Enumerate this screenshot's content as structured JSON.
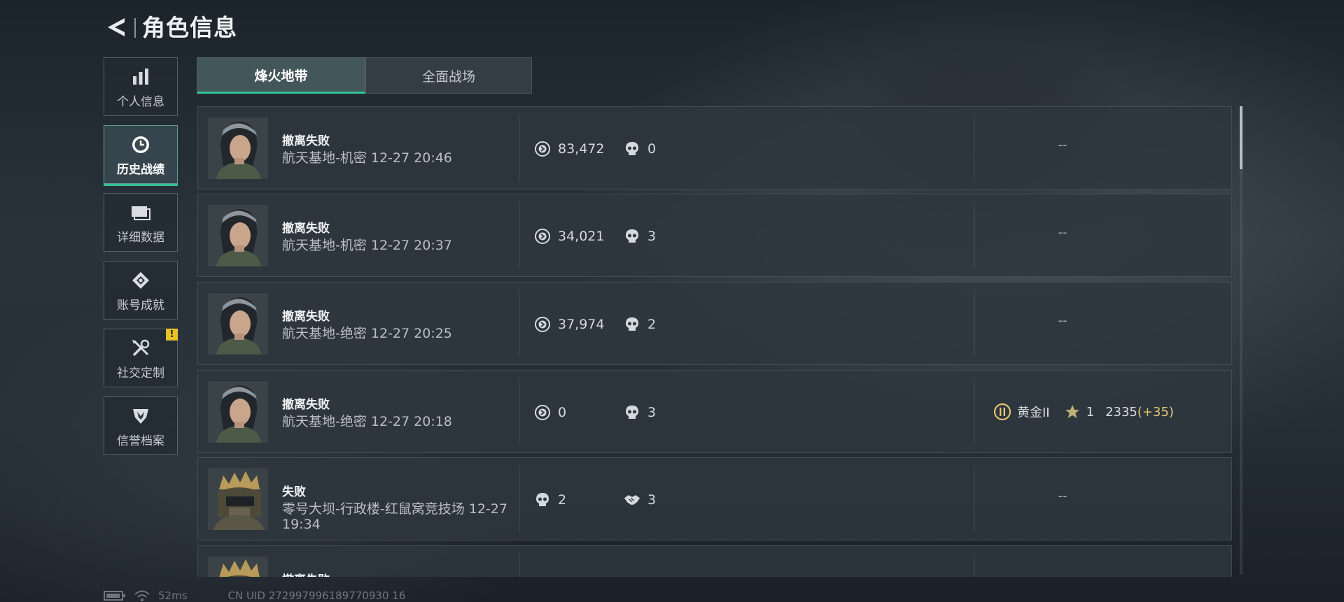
{
  "header": {
    "title": "角色信息",
    "back_icon": "back-arrow-icon"
  },
  "sidebar": {
    "items": [
      {
        "label": "个人信息",
        "icon": "bar-chart-icon",
        "active": false
      },
      {
        "label": "历史战绩",
        "icon": "clock-icon",
        "active": true
      },
      {
        "label": "详细数据",
        "icon": "cards-icon",
        "active": false
      },
      {
        "label": "账号成就",
        "icon": "diamond-badge-icon",
        "active": false
      },
      {
        "label": "社交定制",
        "icon": "tools-icon",
        "active": false,
        "badge": "!"
      },
      {
        "label": "信誉档案",
        "icon": "shield-emblem-icon",
        "active": false
      }
    ]
  },
  "tabs": [
    {
      "label": "烽火地带",
      "active": true
    },
    {
      "label": "全面战场",
      "active": false
    }
  ],
  "records": [
    {
      "title": "撤离失败",
      "subtitle": "航天基地-机密 12-27 20:46",
      "stat1": "83,472",
      "stat2": "0",
      "result": "--"
    },
    {
      "title": "撤离失败",
      "subtitle": "航天基地-机密 12-27 20:37",
      "stat1": "34,021",
      "stat2": "3",
      "result": "--"
    },
    {
      "title": "撤离失败",
      "subtitle": "航天基地-绝密 12-27 20:25",
      "stat1": "37,974",
      "stat2": "2",
      "result": "--"
    },
    {
      "title": "撤离失败",
      "subtitle": "航天基地-绝密 12-27 20:18",
      "stat1": "0",
      "stat2": "3",
      "rank": {
        "tier": "黄金II",
        "stars": "1",
        "score": "2335",
        "delta": "(+35)"
      }
    },
    {
      "title": "失败",
      "subtitle": "零号大坝-行政楼-红鼠窝竞技场 12-27 19:34",
      "stat1": "2",
      "stat2": "3",
      "result": "--"
    },
    {
      "title": "撤离失败",
      "subtitle": "",
      "stat1": "",
      "stat2": "",
      "result": ""
    }
  ],
  "footer": {
    "ping": "52ms",
    "uid": "CN UID 272997996189770930 16"
  },
  "colors": {
    "accent": "#34c495",
    "badge": "#e8c227",
    "gold": "#e2c474"
  }
}
